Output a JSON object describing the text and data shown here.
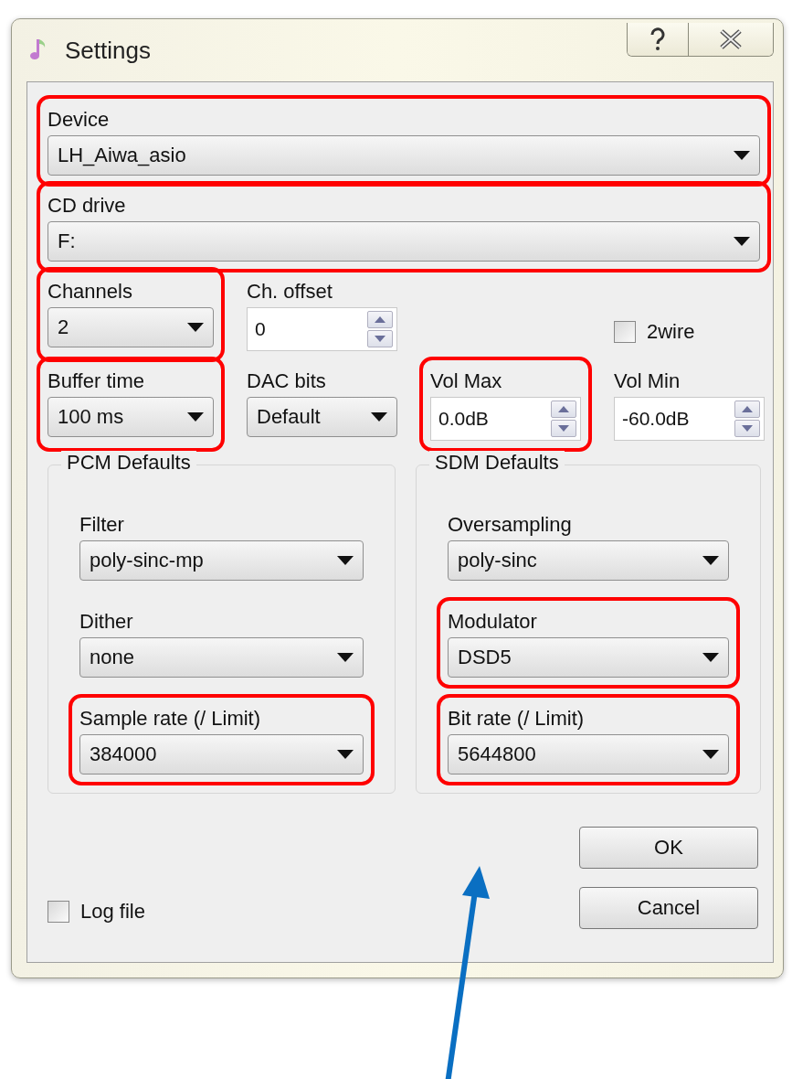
{
  "window": {
    "title": "Settings"
  },
  "top_fields": [
    {
      "kind": "combo",
      "label": "Device",
      "value": "LH_Aiwa_asio",
      "highlighted": true
    },
    {
      "kind": "combo",
      "label": "CD drive",
      "value": "F:",
      "highlighted": true
    }
  ],
  "rows": [
    [
      {
        "kind": "combo",
        "label": "Channels",
        "value": "2",
        "highlighted": true
      },
      {
        "kind": "spin",
        "label": "Ch. offset",
        "value": "0",
        "highlighted": false
      },
      {
        "kind": "empty"
      },
      {
        "kind": "checkbox",
        "label": "2wire",
        "checked": false
      }
    ],
    [
      {
        "kind": "combo",
        "label": "Buffer time",
        "value": "100 ms",
        "highlighted": true
      },
      {
        "kind": "combo",
        "label": "DAC bits",
        "value": "Default",
        "highlighted": false
      },
      {
        "kind": "spin",
        "label": "Vol Max",
        "value": "0.0dB",
        "highlighted": true
      },
      {
        "kind": "spin",
        "label": "Vol Min",
        "value": "-60.0dB",
        "highlighted": false
      }
    ]
  ],
  "groups": [
    {
      "title": "PCM Defaults",
      "fields": [
        {
          "kind": "combo",
          "label": "Filter",
          "value": "poly-sinc-mp",
          "highlighted": false
        },
        {
          "kind": "combo",
          "label": "Dither",
          "value": "none",
          "highlighted": false
        },
        {
          "kind": "combo",
          "label": "Sample rate (/ Limit)",
          "value": "384000",
          "highlighted": true
        }
      ]
    },
    {
      "title": "SDM Defaults",
      "fields": [
        {
          "kind": "combo",
          "label": "Oversampling",
          "value": "poly-sinc",
          "highlighted": false
        },
        {
          "kind": "combo",
          "label": "Modulator",
          "value": "DSD5",
          "highlighted": true
        },
        {
          "kind": "combo",
          "label": "Bit rate (/ Limit)",
          "value": "5644800",
          "highlighted": true
        }
      ]
    }
  ],
  "log_file": {
    "label": "Log file",
    "checked": false
  },
  "buttons": [
    "OK",
    "Cancel"
  ]
}
